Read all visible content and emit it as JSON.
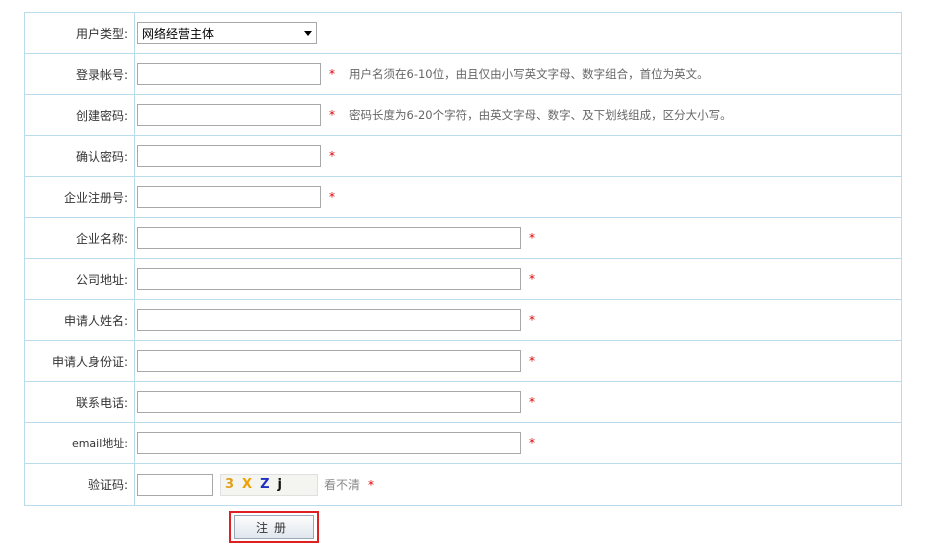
{
  "form": {
    "user_type": {
      "label": "用户类型:",
      "value": "网络经营主体"
    },
    "account": {
      "label": "登录帐号:",
      "value": "",
      "hint": "用户名须在6-10位，由且仅由小写英文字母、数字组合，首位为英文。"
    },
    "password": {
      "label": "创建密码:",
      "value": "",
      "hint": "密码长度为6-20个字符，由英文字母、数字、及下划线组成，区分大小写。"
    },
    "confirm_password": {
      "label": "确认密码:",
      "value": ""
    },
    "company_reg_no": {
      "label": "企业注册号:",
      "value": ""
    },
    "company_name": {
      "label": "企业名称:",
      "value": ""
    },
    "company_address": {
      "label": "公司地址:",
      "value": ""
    },
    "applicant_name": {
      "label": "申请人姓名:",
      "value": ""
    },
    "applicant_id": {
      "label": "申请人身份证:",
      "value": ""
    },
    "phone": {
      "label": "联系电话:",
      "value": ""
    },
    "email": {
      "label": "email地址:",
      "value": ""
    },
    "captcha": {
      "label": "验证码:",
      "value": "",
      "image_chars": [
        "3",
        "X",
        "Z",
        "j"
      ],
      "refresh_label": "看不清"
    },
    "required_mark": "*",
    "submit_label": "注册"
  }
}
